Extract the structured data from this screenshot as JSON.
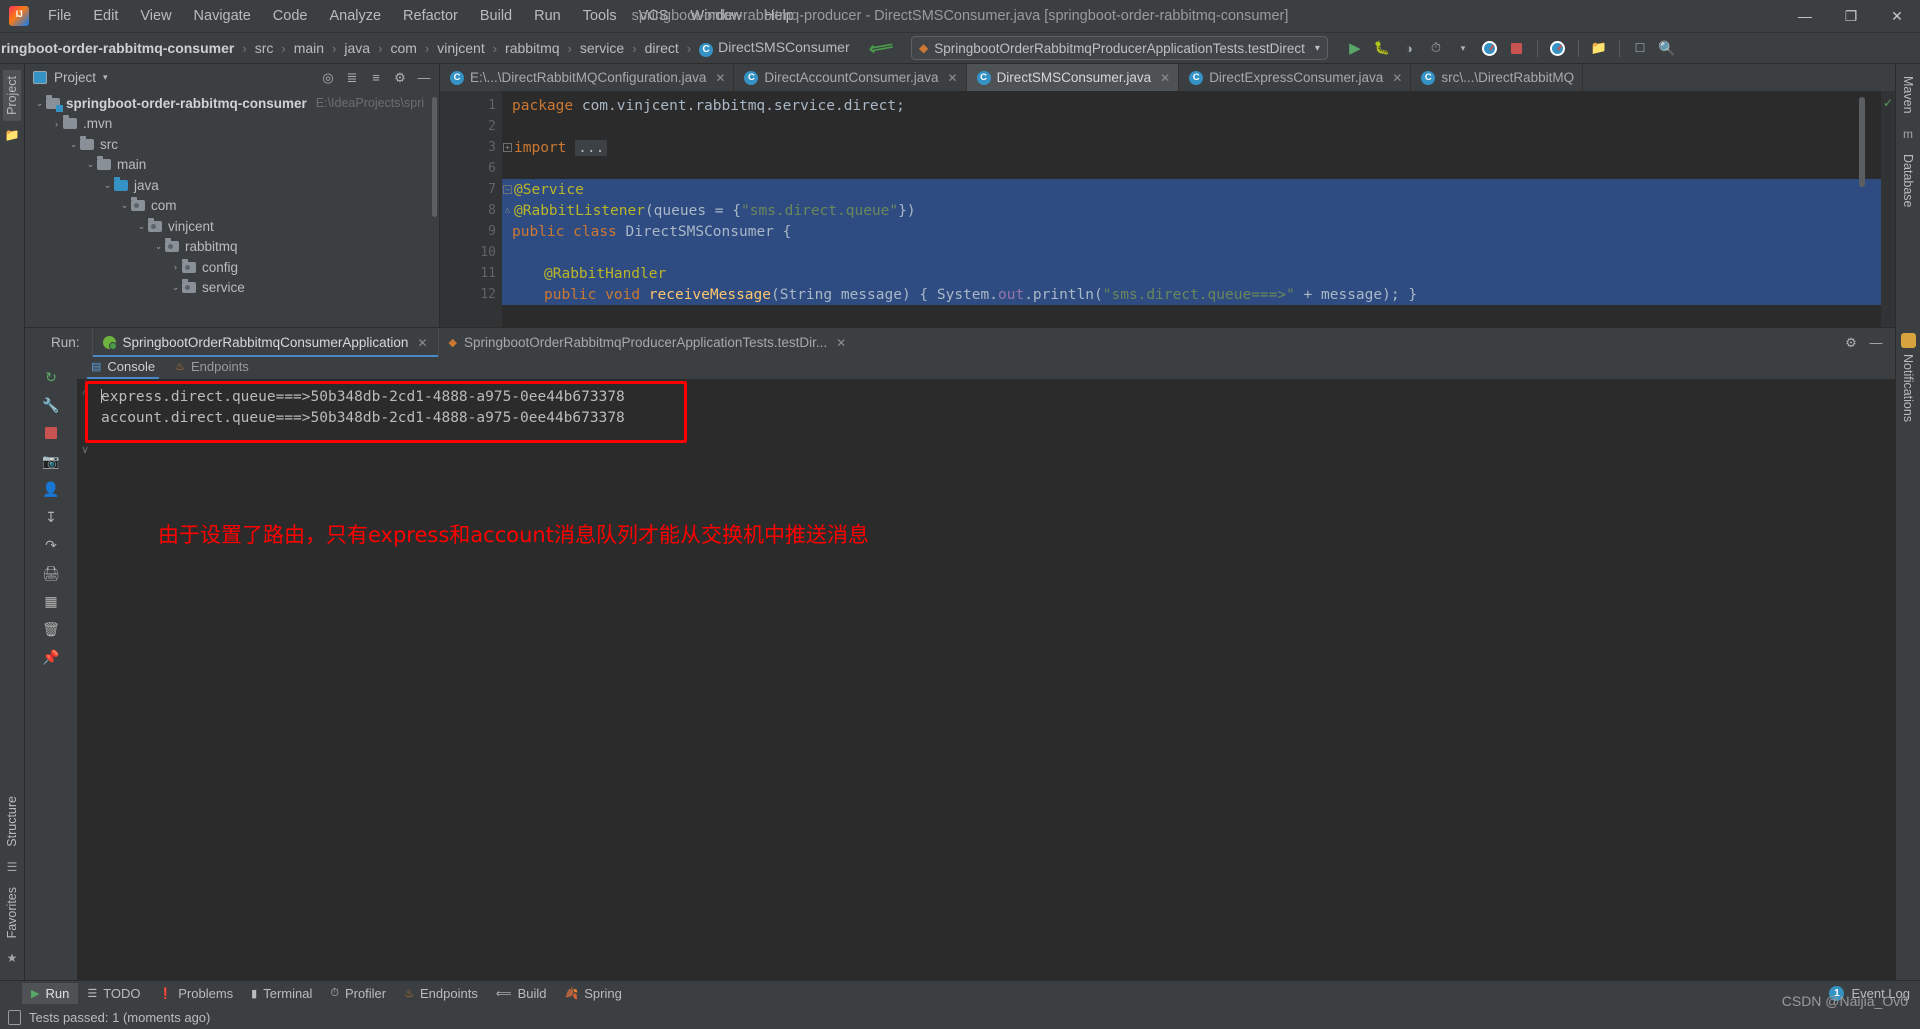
{
  "window": {
    "title": "springboot-order-rabbitmq-producer - DirectSMSConsumer.java [springboot-order-rabbitmq-consumer]",
    "minimize": "—",
    "maximize": "❐",
    "close": "✕"
  },
  "menu": [
    "File",
    "Edit",
    "View",
    "Navigate",
    "Code",
    "Analyze",
    "Refactor",
    "Build",
    "Run",
    "Tools",
    "VCS",
    "Window",
    "Help"
  ],
  "breadcrumb": {
    "items": [
      {
        "label": "ringboot-order-rabbitmq-consumer",
        "bold": true
      },
      {
        "label": "src"
      },
      {
        "label": "main"
      },
      {
        "label": "java"
      },
      {
        "label": "com"
      },
      {
        "label": "vinjcent"
      },
      {
        "label": "rabbitmq"
      },
      {
        "label": "service"
      },
      {
        "label": "direct"
      },
      {
        "label": "DirectSMSConsumer",
        "icon": "C"
      }
    ],
    "separator": "›"
  },
  "run_config": {
    "name": "SpringbootOrderRabbitmqProducerApplicationTests.testDirect",
    "caret": "▾"
  },
  "toolbar_right": [
    "run-icon",
    "debug-icon",
    "run-with-coverage-icon",
    "profiler-icon",
    "profiler-dropdown-icon",
    "coverage-icon",
    "stop-icon",
    "coverage-gauge-icon",
    "project-structure-icon",
    "terminal-icon",
    "search-everywhere-icon"
  ],
  "left_strip": {
    "project_label": "Project",
    "structure_label": "Structure",
    "favorites_label": "Favorites"
  },
  "right_strip": {
    "maven_label": "Maven",
    "database_label": "Database",
    "notifications_label": "Notifications"
  },
  "project_panel": {
    "title": "Project",
    "caret": "▾",
    "actions": [
      "locate-icon",
      "expand-all-icon",
      "collapse-all-icon",
      "settings-icon",
      "hide-icon"
    ],
    "tree": [
      {
        "depth": 0,
        "twist": "⌄",
        "icon": "module",
        "label": "springboot-order-rabbitmq-consumer",
        "bold": true,
        "path": "E:\\IdeaProjects\\spri"
      },
      {
        "depth": 1,
        "twist": "›",
        "icon": "folder",
        "label": ".mvn",
        "bold": false,
        "path": ""
      },
      {
        "depth": 1,
        "twist": "⌄",
        "icon": "folder",
        "label": "src",
        "bold": false,
        "path": ""
      },
      {
        "depth": 2,
        "twist": "⌄",
        "icon": "folder",
        "label": "main",
        "bold": false,
        "path": ""
      },
      {
        "depth": 3,
        "twist": "⌄",
        "icon": "source",
        "label": "java",
        "bold": false,
        "path": ""
      },
      {
        "depth": 4,
        "twist": "⌄",
        "icon": "package",
        "label": "com",
        "bold": false,
        "path": ""
      },
      {
        "depth": 5,
        "twist": "⌄",
        "icon": "package",
        "label": "vinjcent",
        "bold": false,
        "path": ""
      },
      {
        "depth": 6,
        "twist": "⌄",
        "icon": "package",
        "label": "rabbitmq",
        "bold": false,
        "path": ""
      },
      {
        "depth": 7,
        "twist": "›",
        "icon": "package",
        "label": "config",
        "bold": false,
        "path": ""
      },
      {
        "depth": 7,
        "twist": "⌄",
        "icon": "package",
        "label": "service",
        "bold": false,
        "path": ""
      }
    ]
  },
  "editor_tabs": [
    {
      "label": "E:\\...\\DirectRabbitMQConfiguration.java",
      "active": false,
      "close": "✕"
    },
    {
      "label": "DirectAccountConsumer.java",
      "active": false,
      "close": "✕"
    },
    {
      "label": "DirectSMSConsumer.java",
      "active": true,
      "close": "✕"
    },
    {
      "label": "DirectExpressConsumer.java",
      "active": false,
      "close": "✕"
    },
    {
      "label": "src\\...\\DirectRabbitMQ",
      "active": false,
      "close": "✕"
    }
  ],
  "code": {
    "lines": [
      {
        "num": "1",
        "selected": false,
        "gutter_icon": ""
      },
      {
        "num": "2",
        "selected": false,
        "gutter_icon": ""
      },
      {
        "num": "3",
        "selected": false,
        "gutter_icon": ""
      },
      {
        "num": "6",
        "selected": false,
        "gutter_icon": ""
      },
      {
        "num": "7",
        "selected": true,
        "gutter_icon": "bean"
      },
      {
        "num": "8",
        "selected": true,
        "gutter_icon": ""
      },
      {
        "num": "9",
        "selected": true,
        "gutter_icon": "bean"
      },
      {
        "num": "10",
        "selected": true,
        "gutter_icon": ""
      },
      {
        "num": "11",
        "selected": true,
        "gutter_icon": ""
      },
      {
        "num": "12",
        "selected": true,
        "gutter_icon": ""
      }
    ],
    "text": {
      "l1_kw": "package",
      "l1_rest": " com.vinjcent.rabbitmq.service.direct;",
      "l3_kw": "import",
      "l3_collapse": "...",
      "l7": "@Service",
      "l8_ann": "@RabbitListener",
      "l8_open": "(queues = {",
      "l8_str": "\"sms.direct.queue\"",
      "l8_close": "})",
      "l9_kw1": "public",
      "l9_kw2": "class",
      "l9_name": " DirectSMSConsumer {",
      "l11": "@RabbitHandler",
      "l12_kw1": "public",
      "l12_kw2": "void",
      "l12_m": " receiveMessage",
      "l12_args": "(String message) { System.",
      "l12_fld": "out",
      "l12_p": ".println(",
      "l12_str": "\"sms.direct.queue===>\"",
      "l12_end": " + message); }"
    }
  },
  "run_window": {
    "label": "Run:",
    "tabs": [
      {
        "label": "SpringbootOrderRabbitmqConsumerApplication",
        "active": true,
        "icon": "spring-boot-icon",
        "close": "✕"
      },
      {
        "label": "SpringbootOrderRabbitmqProducerApplicationTests.testDir...",
        "active": false,
        "icon": "test-icon",
        "close": "✕"
      }
    ],
    "header_actions": [
      "settings-icon",
      "hide-icon"
    ],
    "gutter_actions": [
      "rerun-icon",
      "build-icon",
      "stop-icon",
      "screenshot-icon",
      "thread-dump-icon",
      "scroll-to-end-icon",
      "soft-wrap-icon",
      "print-icon",
      "clear-all-icon",
      "trash-icon",
      "pin-icon"
    ],
    "console_tabs": [
      {
        "label": "Console",
        "active": true,
        "icon": "console-icon"
      },
      {
        "label": "Endpoints",
        "active": false,
        "icon": "endpoints-icon"
      }
    ],
    "output": [
      "express.direct.queue===>50b348db-2cd1-4888-a975-0ee44b673378",
      "account.direct.queue===>50b348db-2cd1-4888-a975-0ee44b673378"
    ],
    "annotation": "由于设置了路由，只有express和account消息队列才能从交换机中推送消息"
  },
  "bottom_bar": {
    "items": [
      {
        "label": "Run",
        "icon": "run-icon",
        "active": true
      },
      {
        "label": "TODO",
        "icon": "todo-icon",
        "active": false
      },
      {
        "label": "Problems",
        "icon": "problems-icon",
        "active": false
      },
      {
        "label": "Terminal",
        "icon": "terminal-icon",
        "active": false
      },
      {
        "label": "Profiler",
        "icon": "profiler-icon",
        "active": false
      },
      {
        "label": "Endpoints",
        "icon": "endpoints-icon",
        "active": false
      },
      {
        "label": "Build",
        "icon": "build-icon",
        "active": false
      },
      {
        "label": "Spring",
        "icon": "spring-icon",
        "active": false
      }
    ],
    "event_log": {
      "count": "1",
      "label": "Event Log"
    }
  },
  "status_bar": {
    "text": "Tests passed: 1 (moments ago)"
  },
  "watermark": {
    "text": "CSDN @Naijia_Ov0"
  },
  "colors": {
    "accent": "#4a88c7",
    "selection": "#2f4c82",
    "annotation_red": "#ff0000",
    "keyword": "#cc7832",
    "string": "#6a8759",
    "annotation_yellow": "#bbb529"
  }
}
